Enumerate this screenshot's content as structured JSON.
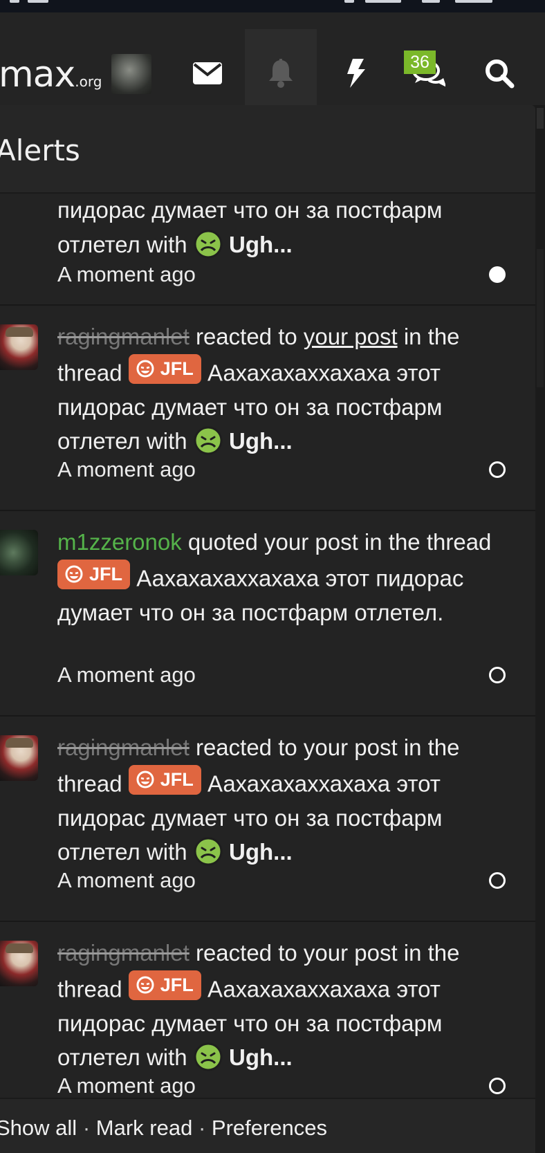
{
  "navbar": {
    "logo_main": "max",
    "logo_suffix": ".org",
    "badge_count": "36",
    "icons": [
      "avatar",
      "envelope-icon",
      "bell-icon",
      "bolt-icon",
      "comments-icon",
      "search-icon"
    ]
  },
  "alerts_panel": {
    "title": "Alerts",
    "items": [
      {
        "type": "reaction-partial",
        "user": "",
        "text_before_prefix": "",
        "prefix_label": "",
        "thread_tail": "пидорас думает что он за постфарм отлетел",
        "with": "with",
        "reaction": "Ugh...",
        "time": "A moment ago",
        "status": "unread"
      },
      {
        "type": "reaction",
        "user": "ragingmanlet",
        "action": "reacted to",
        "link_text": "your post",
        "in_thread": "in the thread",
        "prefix_label": "JFL",
        "thread_title": "Аахахахаххахаха этот пидорас думает что он за постфарм отлетел",
        "with": "with",
        "reaction": "Ugh...",
        "time": "A moment ago",
        "status": "read"
      },
      {
        "type": "quote",
        "user": "m1zzeronok",
        "action": "quoted your post in the",
        "in_thread": "thread",
        "prefix_label": "JFL",
        "thread_title": "Аахахахаххахаха этот пидорас думает что он за постфарм отлетел.",
        "time": "A moment ago",
        "status": "read"
      },
      {
        "type": "reaction",
        "user": "ragingmanlet",
        "action": "reacted to your post in the",
        "in_thread": "thread",
        "prefix_label": "JFL",
        "thread_title": "Аахахахаххахаха этот пидорас думает что он за постфарм отлетел",
        "with": "with",
        "reaction": "Ugh...",
        "time": "A moment ago",
        "status": "read"
      },
      {
        "type": "reaction",
        "user": "ragingmanlet",
        "action": "reacted to your post in the",
        "in_thread": "thread",
        "prefix_label": "JFL",
        "thread_title": "Аахахахаххахаха этот пидорас думает что он за постфарм отлетел",
        "with": "with",
        "reaction": "Ugh...",
        "time": "A moment ago",
        "status": "read"
      }
    ]
  },
  "footer": {
    "show_all": "Show all",
    "mark_read": "Mark read",
    "preferences": "Preferences",
    "separator": "·"
  },
  "colors": {
    "accent_prefix": "#e06640",
    "badge": "#7bb82a",
    "username_green": "#55b34a",
    "panel_bg": "#232323"
  }
}
